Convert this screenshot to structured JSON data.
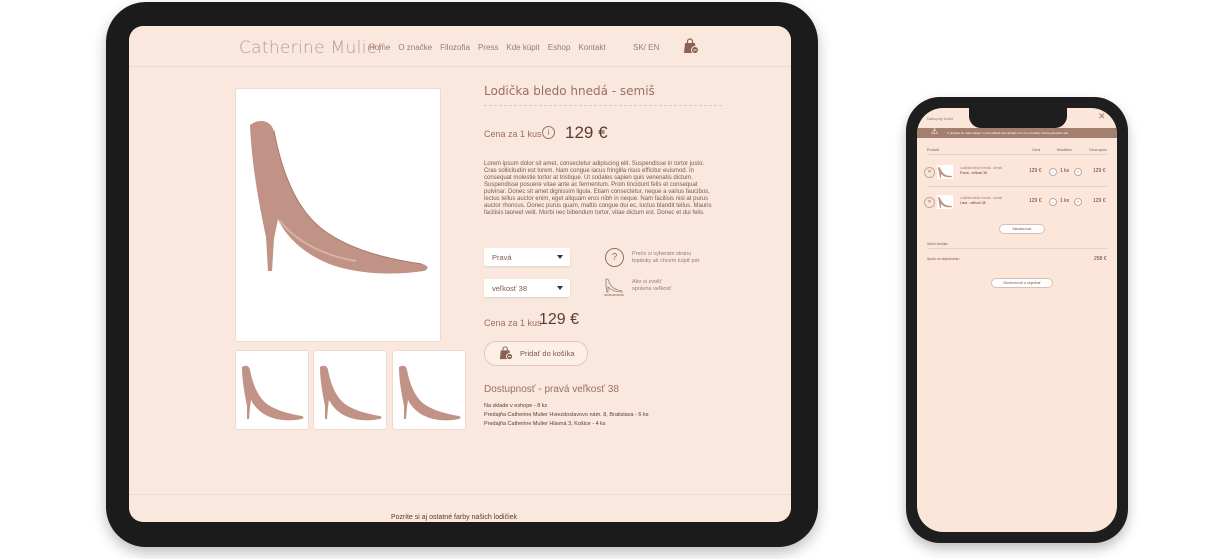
{
  "colors": {
    "background": "#fae8de",
    "accent": "#9a6f60",
    "text_dark": "#5e3a2e",
    "warning_bar": "#a47e6e"
  },
  "tablet": {
    "brand": "Catherine Mulier",
    "nav": [
      "Home",
      "O značke",
      "Filozofia",
      "Press",
      "Kde kúpit",
      "Eshop",
      "Kontakt"
    ],
    "lang": "SK/ EN",
    "bag_icon": "shopping-bag-icon",
    "product": {
      "title": "Lodička bledo hnedá - semiš",
      "price_label": "Cena za 1 kus",
      "price": "129 €",
      "description": "Lorem ipsum dolor sit amet, consectetur adipiscing elit. Suspendisse in tortor justo. Cras sollicitudin est lorem. Nam congue lacus fringilla risus efficitur euismod. In consequat molestie tortor at tristique. Ut sodales sapien quis venenatis dictum. Suspendisse posuere vitae ante ac fermentum. Proin tincidunt felis et consequat pulvinar. Donec sit amet dignissim ligula. Etiam consectetur, neque a varius faucibus, lectus tellus auctor enim, eget aliquam eros nibh in neque. Nam facilisis nisl at purus auctor rhoncus. Donec purus quam, mattis congue dui ec, luctus blandit tellus. Mauris facilisis laoreet velit. Morbi nec bibendum tortor, vitae dictum est. Donec et dui felis.",
      "side_select": "Pravá",
      "size_select": "veľkosť 38",
      "help_side": "Prečo si vyberám stranu topánky ak chcem kúpiť pár",
      "help_size": "Ako si zvoliť správnu veľkosť",
      "price_label_2": "Cena za 1 kus",
      "price_2": "129 €",
      "add_to_cart": "Pridať do košíka",
      "availability_title": "Dostupnosť - pravá veľkosť 38",
      "availability": [
        "Na sklade v eshope - 8 ks",
        "Predajňa Catherine Mulier Hviezdoslavovo nám. 8, Bratislava - 6 ks",
        "Predajňa Catherine Mulier Hlavná 3, Košice - 4 ks"
      ]
    },
    "footer_text": "Pozrite si aj ostatné farby našich lodičiek"
  },
  "phone": {
    "header": "Nákupný košík",
    "close_icon": "close-icon",
    "warning": "V prípade že máte záujem o pár lodičiek skontrolujte si či sú vo košíku trochu polovičné pár",
    "columns": [
      "Produkt",
      "Cena",
      "Množstvo",
      "Cena spolu"
    ],
    "items": [
      {
        "name": "Lodička bledo hnedá - semiš",
        "variant": "Pravá - veľkosť 38",
        "price": "129 €",
        "qty": "1 ks",
        "total": "129 €"
      },
      {
        "name": "Lodička bledo hnedá - semiš",
        "variant": "Ľavá - veľkosť 38",
        "price": "129 €",
        "qty": "1 ks",
        "total": "129 €"
      }
    ],
    "update_button": "Aktualizovať",
    "summary_label": "Súhrn košíka",
    "order_total_label": "Spolu za objednávku",
    "order_total": "258 €",
    "checkout_button": "Skontrolovať a objednať"
  }
}
